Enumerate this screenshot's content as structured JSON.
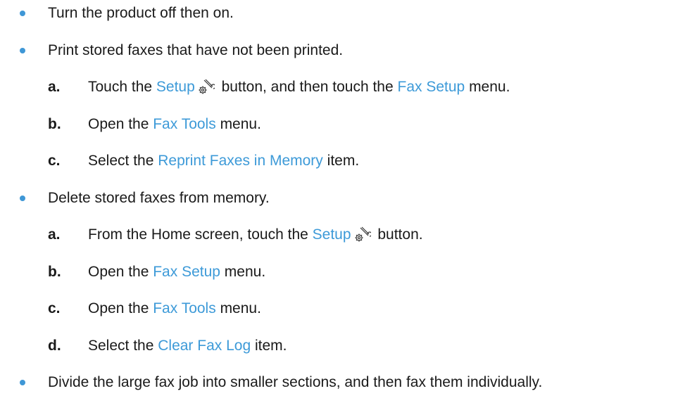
{
  "items": [
    {
      "text": "Turn the product off then on."
    },
    {
      "text": "Print stored faxes that have not been printed.",
      "steps": [
        {
          "letter": "a.",
          "p1": "Touch the ",
          "l1": "Setup",
          "p2": " button, and then touch the ",
          "l2": "Fax Setup",
          "p3": " menu.",
          "icon": "setup-wrench-gear-icon"
        },
        {
          "letter": "b.",
          "p1": "Open the ",
          "l1": "Fax Tools",
          "p2": " menu."
        },
        {
          "letter": "c.",
          "p1": "Select the ",
          "l1": "Reprint Faxes in Memory",
          "p2": " item."
        }
      ]
    },
    {
      "text": "Delete stored faxes from memory.",
      "steps": [
        {
          "letter": "a.",
          "p1": "From the Home screen, touch the ",
          "l1": "Setup",
          "p2": " button.",
          "icon": "setup-wrench-gear-icon"
        },
        {
          "letter": "b.",
          "p1": "Open the ",
          "l1": "Fax Setup",
          "p2": " menu."
        },
        {
          "letter": "c.",
          "p1": "Open the ",
          "l1": "Fax Tools",
          "p2": " menu."
        },
        {
          "letter": "d.",
          "p1": "Select the ",
          "l1": "Clear Fax Log",
          "p2": " item."
        }
      ]
    },
    {
      "text": "Divide the large fax job into smaller sections, and then fax them individually."
    }
  ],
  "colors": {
    "link": "#3d9ad8",
    "bullet": "#3f97d6",
    "text": "#1a1a1a"
  }
}
